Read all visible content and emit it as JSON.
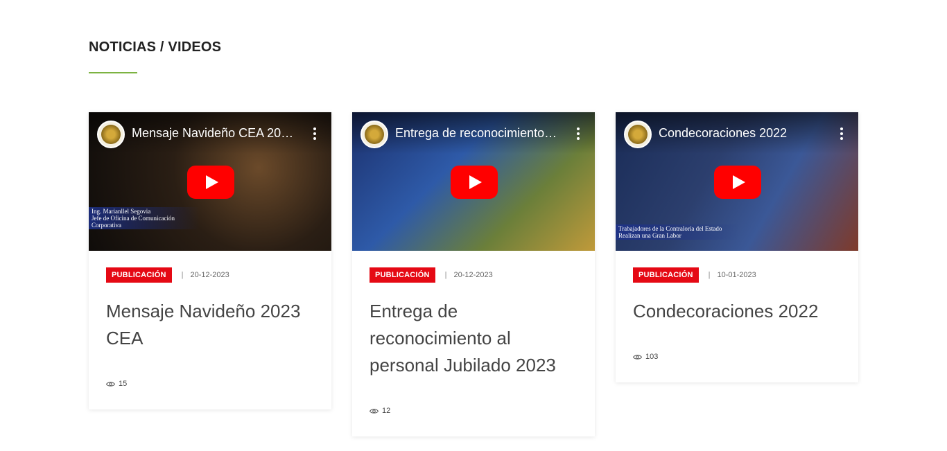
{
  "section": {
    "title": "NOTICIAS / VIDEOS",
    "accent_color": "#7cb342"
  },
  "cards": [
    {
      "video_title": "Mensaje Navideño CEA 20…",
      "caption_line1": "Ing. Marianllel Segovia",
      "caption_line2": "Jefe de Oficina de Comunicación Corporativa",
      "category": "PUBLICACIÓN",
      "date": "20-12-2023",
      "title": "Mensaje Navideño 2023 CEA",
      "views": "15"
    },
    {
      "video_title": "Entrega de reconocimiento…",
      "caption_line1": "",
      "caption_line2": "",
      "category": "PUBLICACIÓN",
      "date": "20-12-2023",
      "title": "Entrega de reconocimiento al personal Jubilado 2023",
      "views": "12"
    },
    {
      "video_title": "Condecoraciones 2022",
      "caption_line1": "Trabajadores de la Contraloría del Estado",
      "caption_line2": "Realizan una Gran Labor",
      "category": "PUBLICACIÓN",
      "date": "10-01-2023",
      "title": "Condecoraciones 2022",
      "views": "103"
    }
  ],
  "colors": {
    "badge": "#e50914",
    "play_button": "#ff0000"
  },
  "icons": {
    "play": "youtube-play-icon",
    "menu": "more-vertical-icon",
    "views": "eye-icon",
    "channel": "channel-logo-icon"
  }
}
